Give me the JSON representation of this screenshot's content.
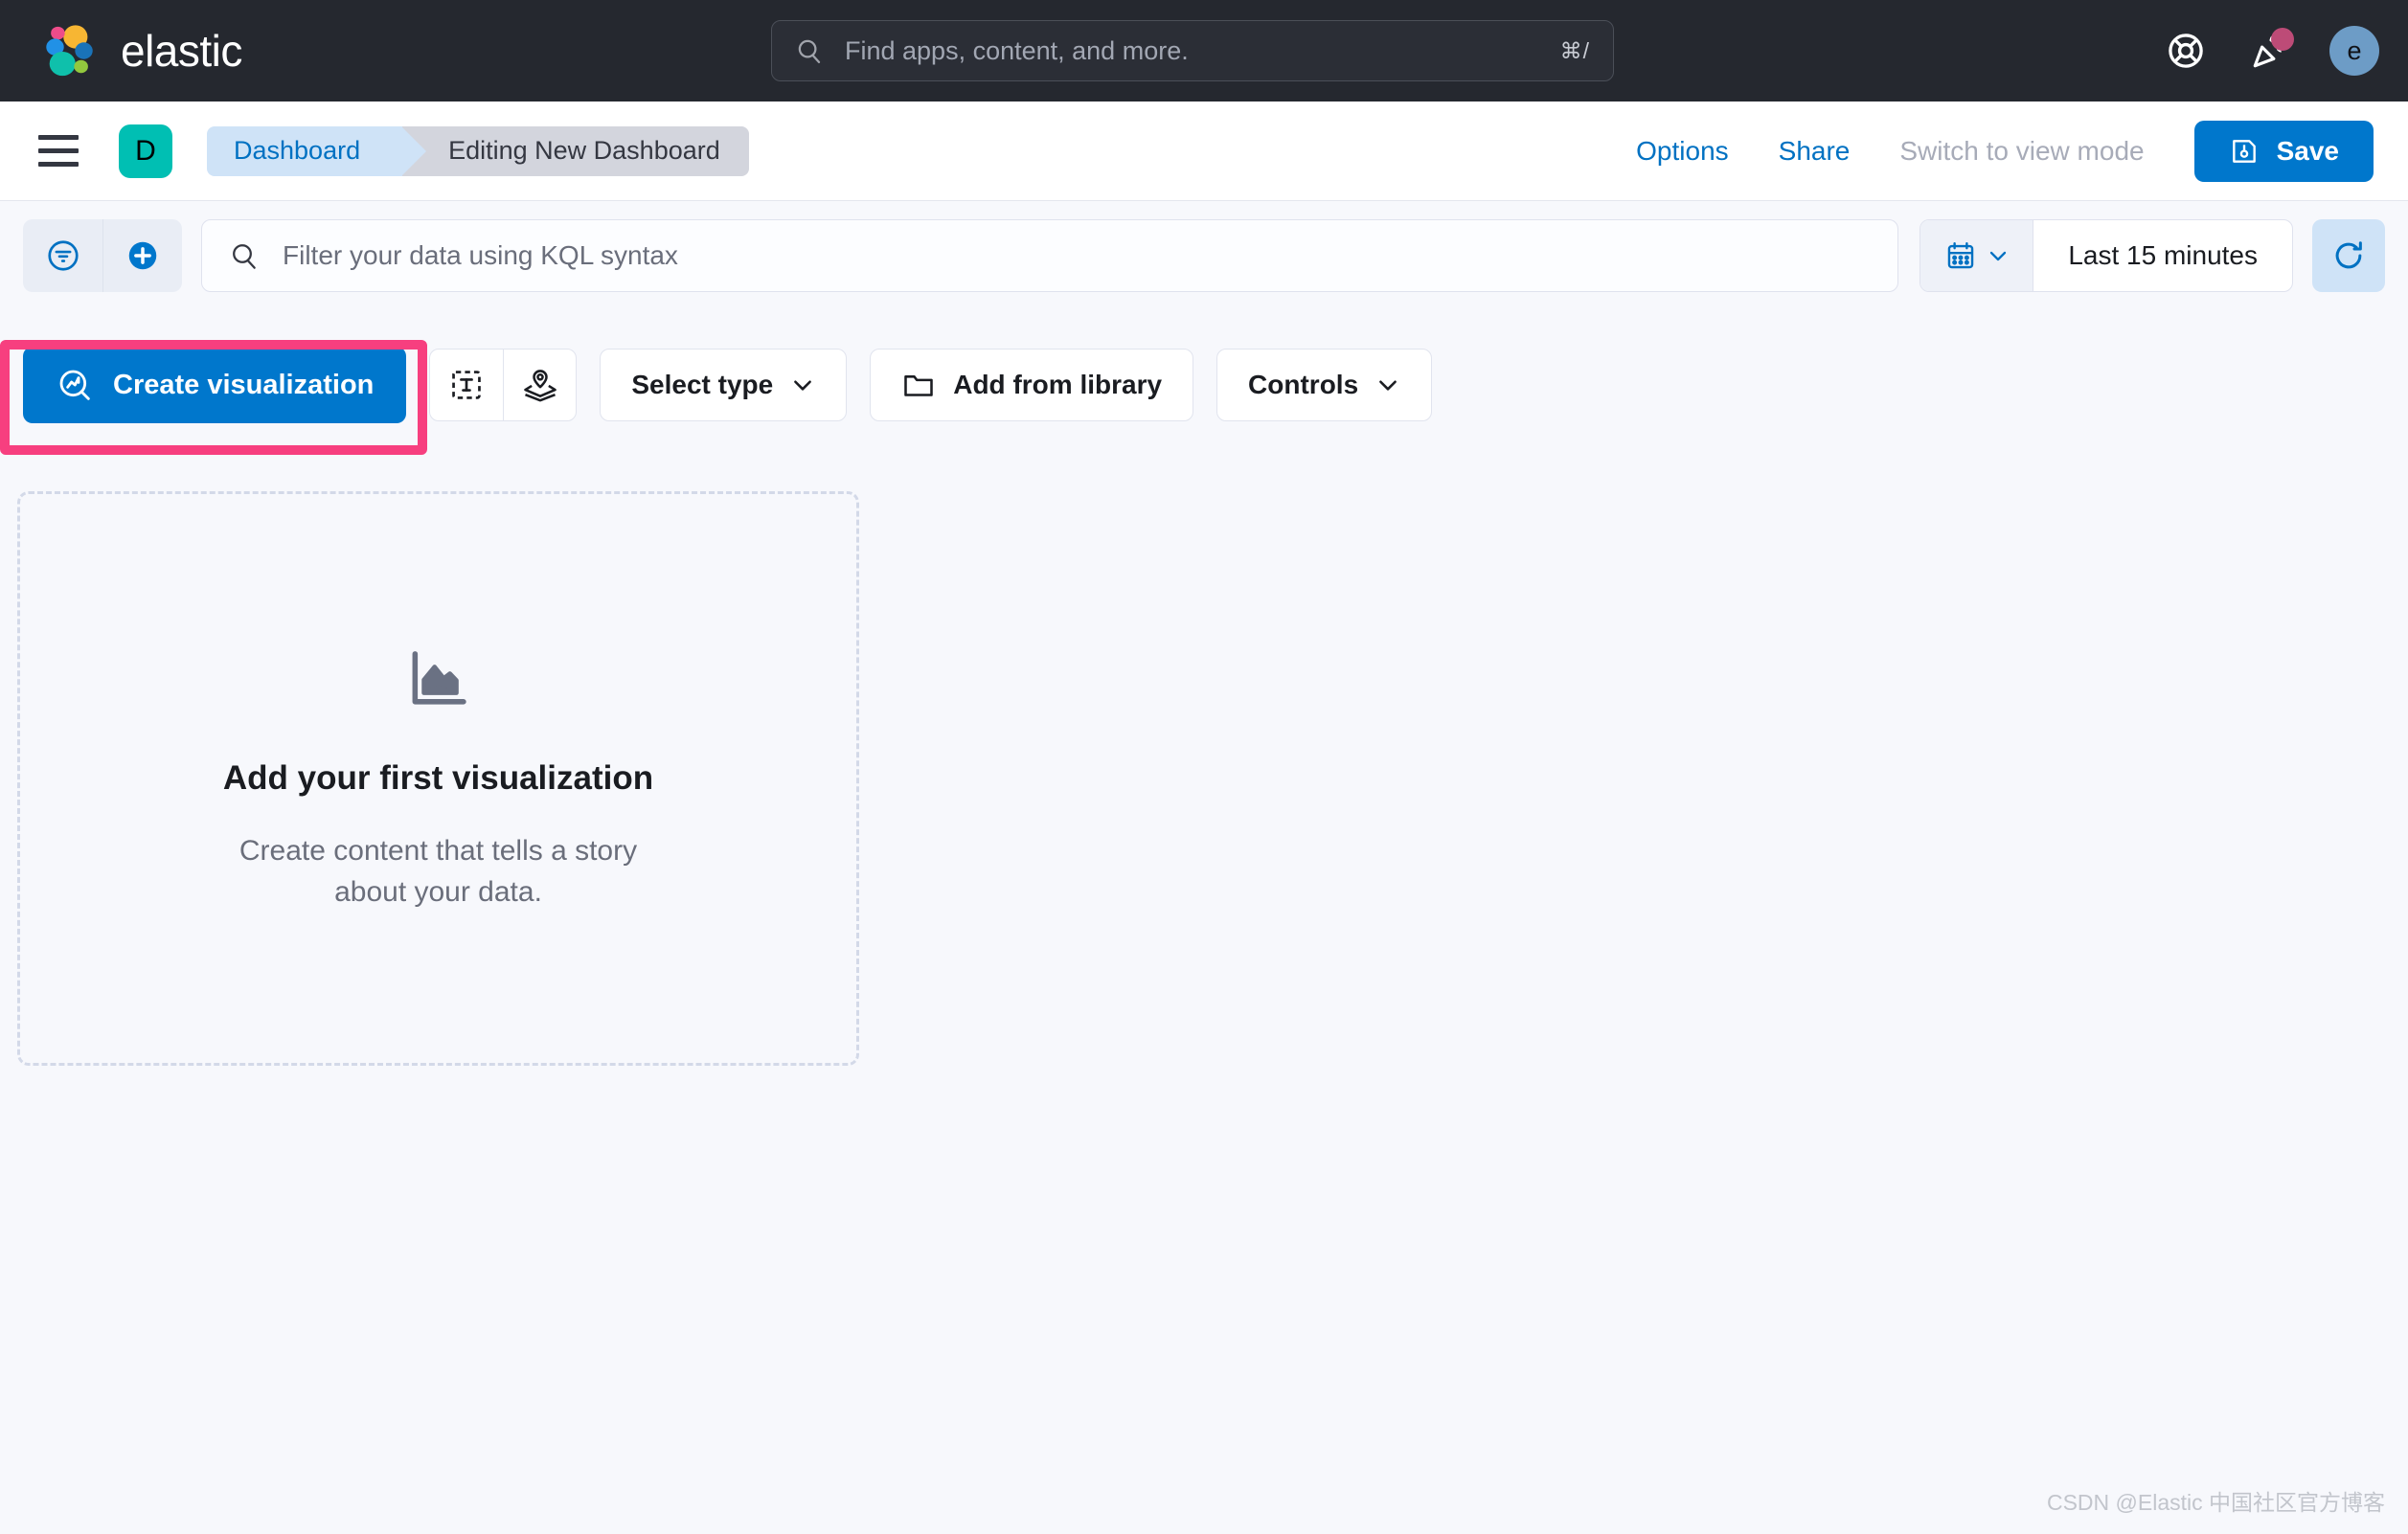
{
  "topnav": {
    "brand_name": "elastic",
    "search": {
      "placeholder": "Find apps, content, and more.",
      "shortcut": "⌘/"
    },
    "help_icon": "lifebuoy-icon",
    "news_icon": "party-popper-icon",
    "avatar_initial": "e"
  },
  "header": {
    "menu_icon": "hamburger-menu-icon",
    "app_badge": "D",
    "breadcrumbs": [
      {
        "label": "Dashboard",
        "active": false
      },
      {
        "label": "Editing New Dashboard",
        "active": true
      }
    ],
    "options_label": "Options",
    "share_label": "Share",
    "view_mode_label": "Switch to view mode",
    "save_label": "Save"
  },
  "querybar": {
    "filter_icon": "filter-icon",
    "add_filter_icon": "plus-circle-icon",
    "kql_placeholder": "Filter your data using KQL syntax",
    "date_range": "Last 15 minutes",
    "refresh_icon": "refresh-icon"
  },
  "toolbar": {
    "create_visualization_label": "Create visualization",
    "text_icon": "text-box-icon",
    "map_icon": "map-layers-icon",
    "select_type_label": "Select type",
    "add_from_library_label": "Add from library",
    "controls_label": "Controls"
  },
  "empty_state": {
    "icon": "area-chart-icon",
    "title": "Add your first visualization",
    "subtitle": "Create content that tells a story about your data."
  },
  "watermark": "CSDN @Elastic 中国社区官方博客",
  "colors": {
    "accent_blue": "#0077cc",
    "link_blue": "#0071c2",
    "app_teal": "#00bfb3",
    "annotation_pink": "#f73f7f",
    "notification_dot": "#bd4b77",
    "dark_nav": "#25282f"
  }
}
